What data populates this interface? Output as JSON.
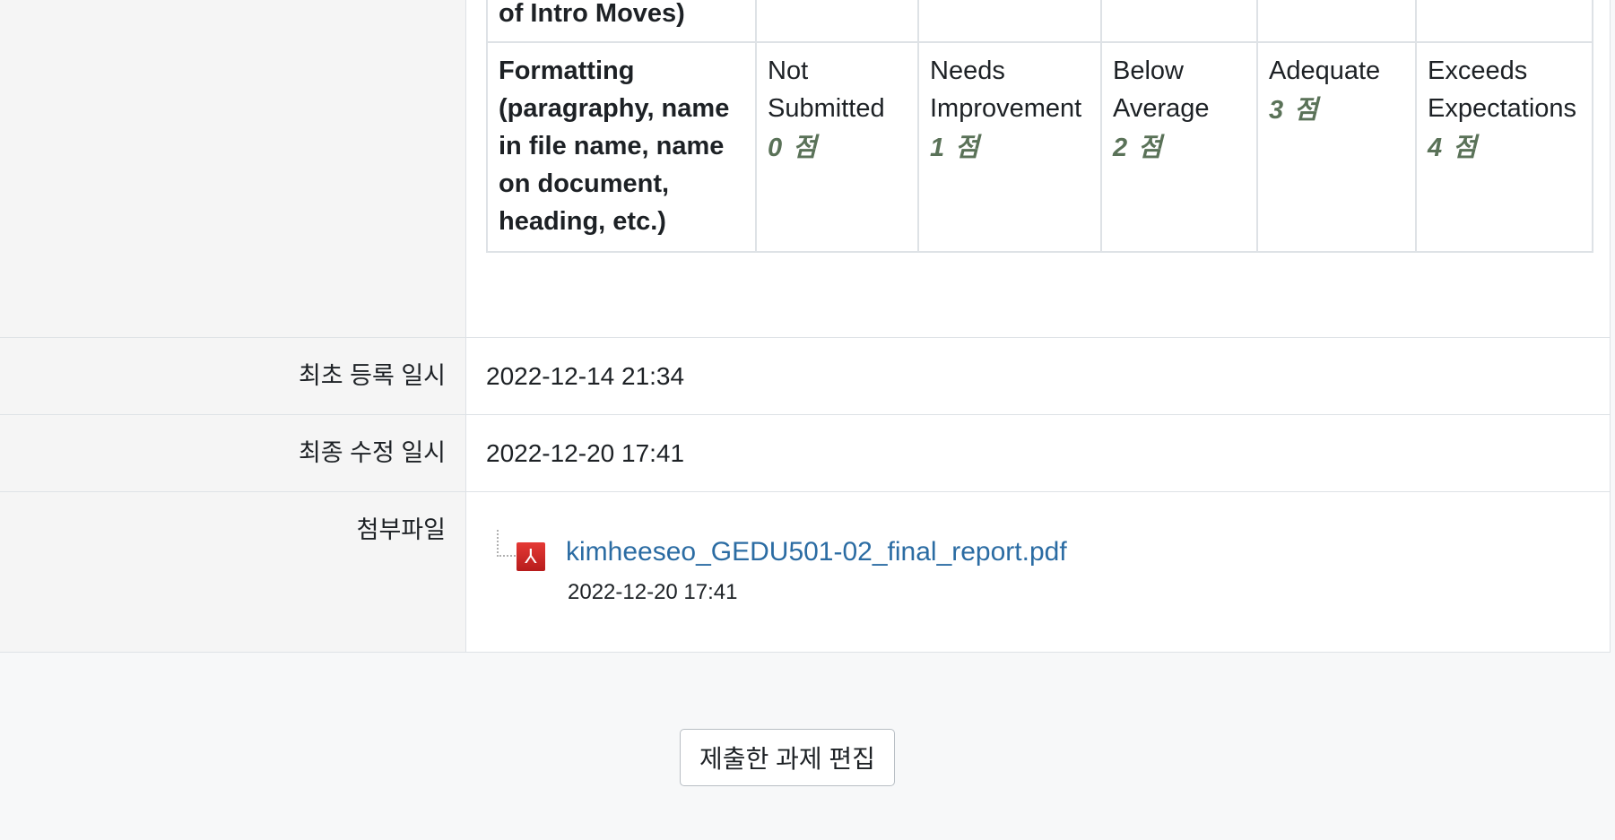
{
  "rubric": {
    "prev_criterion_tail": "of Intro Moves)",
    "criterion": "Formatting (paragraphy, name in file name, name on document, heading, etc.)",
    "levels": [
      {
        "label": "Not Submitted",
        "points": "0 점"
      },
      {
        "label": "Needs Improvement",
        "points": "1 점"
      },
      {
        "label": "Below Average",
        "points": "2 점"
      },
      {
        "label": "Adequate",
        "points": "3 점"
      },
      {
        "label": "Exceeds Expectations",
        "points": "4 점"
      }
    ]
  },
  "created": {
    "label": "최초 등록 일시",
    "value": "2022-12-14 21:34"
  },
  "modified": {
    "label": "최종 수정 일시",
    "value": "2022-12-20 17:41"
  },
  "attachments": {
    "label": "첨부파일",
    "file_name": "kimheeseo_GEDU501-02_final_report.pdf",
    "file_date": "2022-12-20 17:41",
    "icon": "pdf-icon"
  },
  "edit_button_label": "제출한 과제 편집"
}
